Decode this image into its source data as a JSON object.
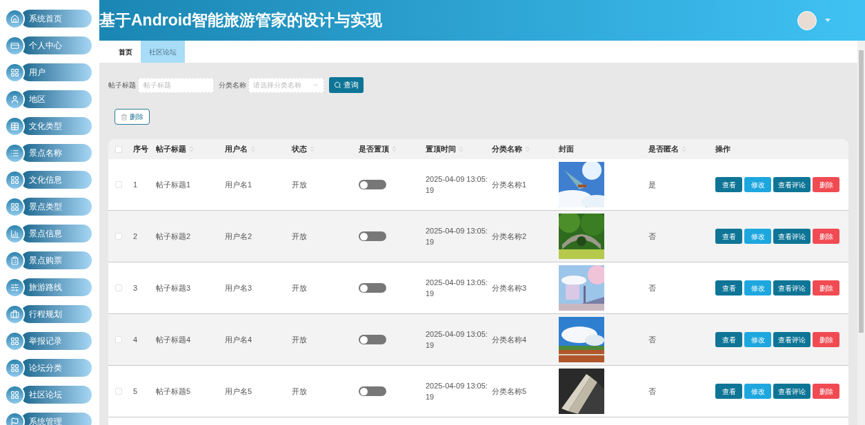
{
  "sidebar": {
    "items": [
      {
        "label": "系统首页"
      },
      {
        "label": "个人中心"
      },
      {
        "label": "用户"
      },
      {
        "label": "地区"
      },
      {
        "label": "文化类型"
      },
      {
        "label": "景点名称"
      },
      {
        "label": "文化信息"
      },
      {
        "label": "景点类型"
      },
      {
        "label": "景点信息"
      },
      {
        "label": "景点购票"
      },
      {
        "label": "旅游路线"
      },
      {
        "label": "行程规划"
      },
      {
        "label": "举报记录"
      },
      {
        "label": "论坛分类"
      },
      {
        "label": "社区论坛"
      },
      {
        "label": "系统管理"
      }
    ]
  },
  "header": {
    "title": "基于Android智能旅游管家的设计与实现"
  },
  "tabs": [
    {
      "label": "首页",
      "selected": false
    },
    {
      "label": "社区论坛",
      "selected": true
    }
  ],
  "search": {
    "fields": [
      {
        "label": "帖子标题",
        "placeholder": "帖子标题",
        "kind": "text"
      },
      {
        "label": "分类名称",
        "placeholder": "请选择分类名称",
        "kind": "select"
      }
    ],
    "button": "查询"
  },
  "bulk_delete": "删除",
  "table": {
    "select_all_checked": false,
    "columns": [
      {
        "label": "序号",
        "sortable": false
      },
      {
        "label": "帖子标题",
        "sortable": true
      },
      {
        "label": "用户名",
        "sortable": true
      },
      {
        "label": "状态",
        "sortable": true
      },
      {
        "label": "是否置顶",
        "sortable": true
      },
      {
        "label": "置顶时间",
        "sortable": true
      },
      {
        "label": "分类名称",
        "sortable": true
      },
      {
        "label": "封面",
        "sortable": false
      },
      {
        "label": "是否匿名",
        "sortable": true
      },
      {
        "label": "操作",
        "sortable": false
      }
    ],
    "rows": [
      {
        "checked": false,
        "index": "1",
        "title": "帖子标题1",
        "user": "用户名1",
        "status": "开放",
        "pinned": false,
        "time": "2025-04-09 13:05:19",
        "category": "分类名称1",
        "cover": {
          "kind": "picture"
        },
        "anonymous": "是",
        "actions": [
          {
            "label": "查看",
            "kind": "view"
          },
          {
            "label": "修改",
            "kind": "edit"
          },
          {
            "label": "查看评论",
            "kind": "comments"
          },
          {
            "label": "删除",
            "kind": "delete"
          }
        ]
      },
      {
        "checked": false,
        "index": "2",
        "title": "帖子标题2",
        "user": "用户名2",
        "status": "开放",
        "pinned": false,
        "time": "2025-04-09 13:05:19",
        "category": "分类名称2",
        "cover": {
          "kind": "picture"
        },
        "anonymous": "否",
        "actions": [
          {
            "label": "查看",
            "kind": "view"
          },
          {
            "label": "修改",
            "kind": "edit"
          },
          {
            "label": "查看评论",
            "kind": "comments"
          },
          {
            "label": "删除",
            "kind": "delete"
          }
        ]
      },
      {
        "checked": false,
        "index": "3",
        "title": "帖子标题3",
        "user": "用户名3",
        "status": "开放",
        "pinned": false,
        "time": "2025-04-09 13:05:19",
        "category": "分类名称3",
        "cover": {
          "kind": "picture"
        },
        "anonymous": "否",
        "actions": [
          {
            "label": "查看",
            "kind": "view"
          },
          {
            "label": "修改",
            "kind": "edit"
          },
          {
            "label": "查看评论",
            "kind": "comments"
          },
          {
            "label": "删除",
            "kind": "delete"
          }
        ]
      },
      {
        "checked": false,
        "index": "4",
        "title": "帖子标题4",
        "user": "用户名4",
        "status": "开放",
        "pinned": false,
        "time": "2025-04-09 13:05:19",
        "category": "分类名称4",
        "cover": {
          "kind": "picture"
        },
        "anonymous": "否",
        "actions": [
          {
            "label": "查看",
            "kind": "view"
          },
          {
            "label": "修改",
            "kind": "edit"
          },
          {
            "label": "查看评论",
            "kind": "comments"
          },
          {
            "label": "删除",
            "kind": "delete"
          }
        ]
      },
      {
        "checked": false,
        "index": "5",
        "title": "帖子标题5",
        "user": "用户名5",
        "status": "开放",
        "pinned": false,
        "time": "2025-04-09 13:05:19",
        "category": "分类名称5",
        "cover": {
          "kind": "picture"
        },
        "anonymous": "否",
        "actions": [
          {
            "label": "查看",
            "kind": "view"
          },
          {
            "label": "修改",
            "kind": "edit"
          },
          {
            "label": "查看评论",
            "kind": "comments"
          },
          {
            "label": "删除",
            "kind": "delete"
          }
        ]
      }
    ]
  }
}
